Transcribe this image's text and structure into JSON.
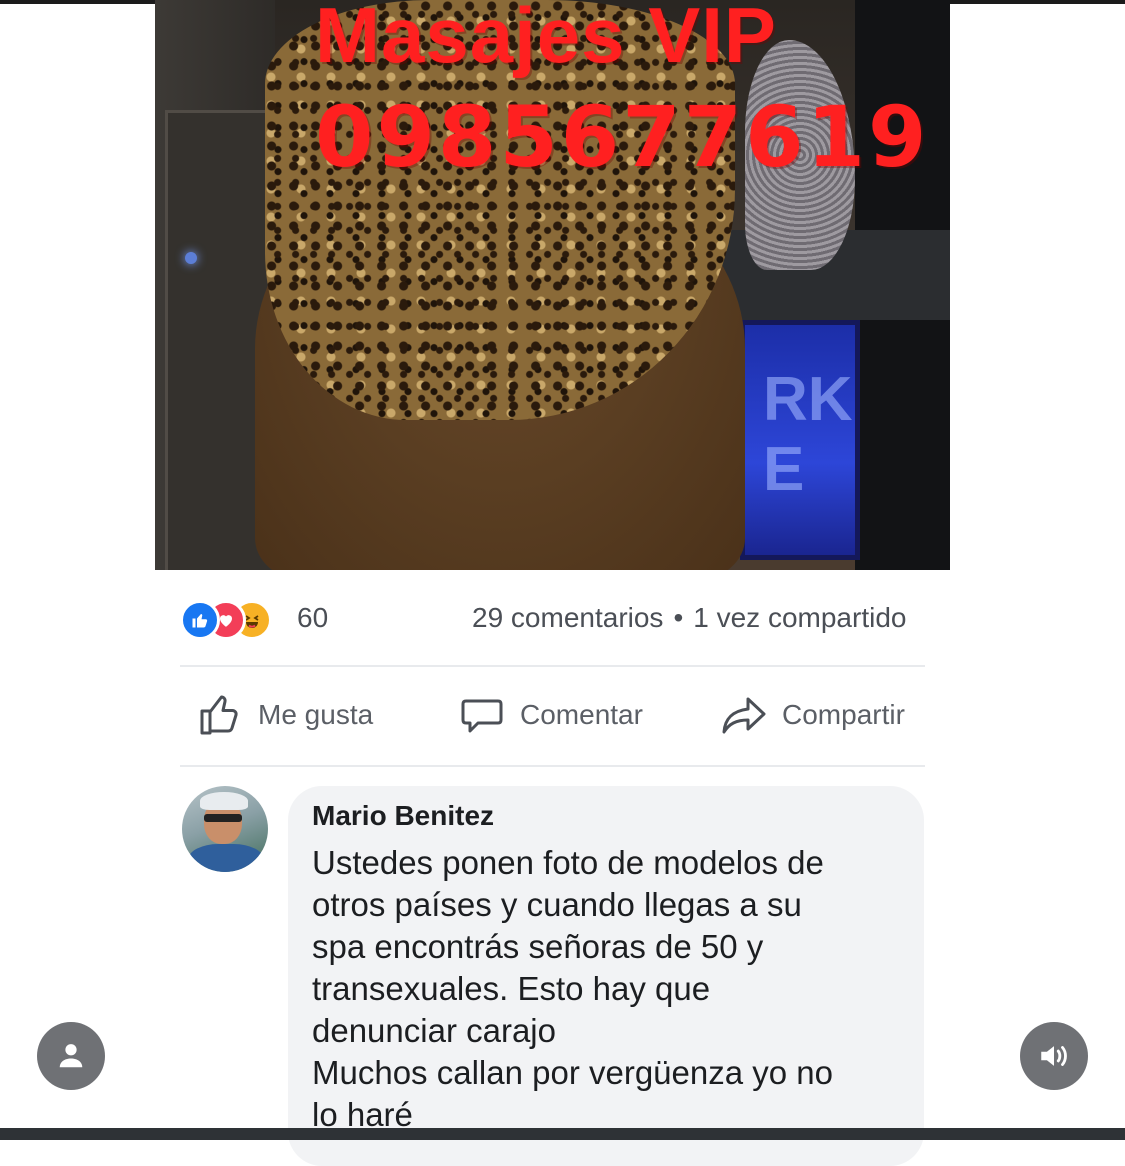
{
  "post": {
    "image_text": {
      "line1": "Masajes VIP",
      "line2": "0985677619"
    },
    "stats": {
      "reaction_count": "60",
      "comments": "29 comentarios",
      "separator": "•",
      "shares": "1 vez compartido"
    },
    "reactions": [
      "like-icon",
      "love-icon",
      "haha-icon"
    ],
    "actions": {
      "like": "Me gusta",
      "comment": "Comentar",
      "share": "Compartir"
    }
  },
  "comment": {
    "author": "Mario Benitez",
    "text": "Ustedes ponen foto de modelos de\notros países y cuando llegas a su\nspa encontrás señoras de 50 y\ntransexuales.  Esto hay que\ndenunciar carajo\nMuchos callan por vergüenza yo no\nlo haré"
  },
  "overlay": {
    "left_button_icon": "person-icon",
    "right_button_icon": "speaker-icon"
  },
  "colors": {
    "ad_text": "#ff2020",
    "like_blue": "#1877f2",
    "love_red": "#f33e58",
    "haha_yellow": "#f7b125",
    "bubble_bg": "#f2f3f5",
    "meta_text": "#4b4f56"
  }
}
